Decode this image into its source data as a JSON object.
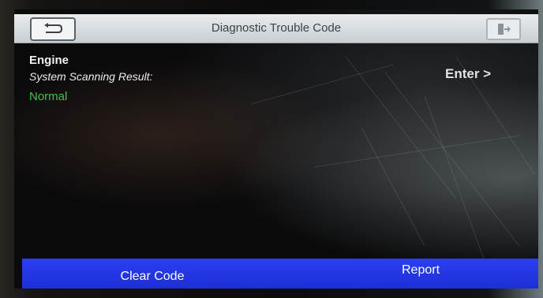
{
  "header": {
    "title": "Diagnostic Trouble Code",
    "back_icon": "back-arrow-icon",
    "exit_icon": "exit-icon"
  },
  "result": {
    "system_name": "Engine",
    "scan_label": "System Scanning Result:",
    "status": "Normal",
    "status_color": "#3fc34a",
    "enter_label": "Enter >"
  },
  "footer": {
    "clear_code_label": "Clear Code",
    "report_label": "Report",
    "bar_color": "#1f34e0"
  }
}
